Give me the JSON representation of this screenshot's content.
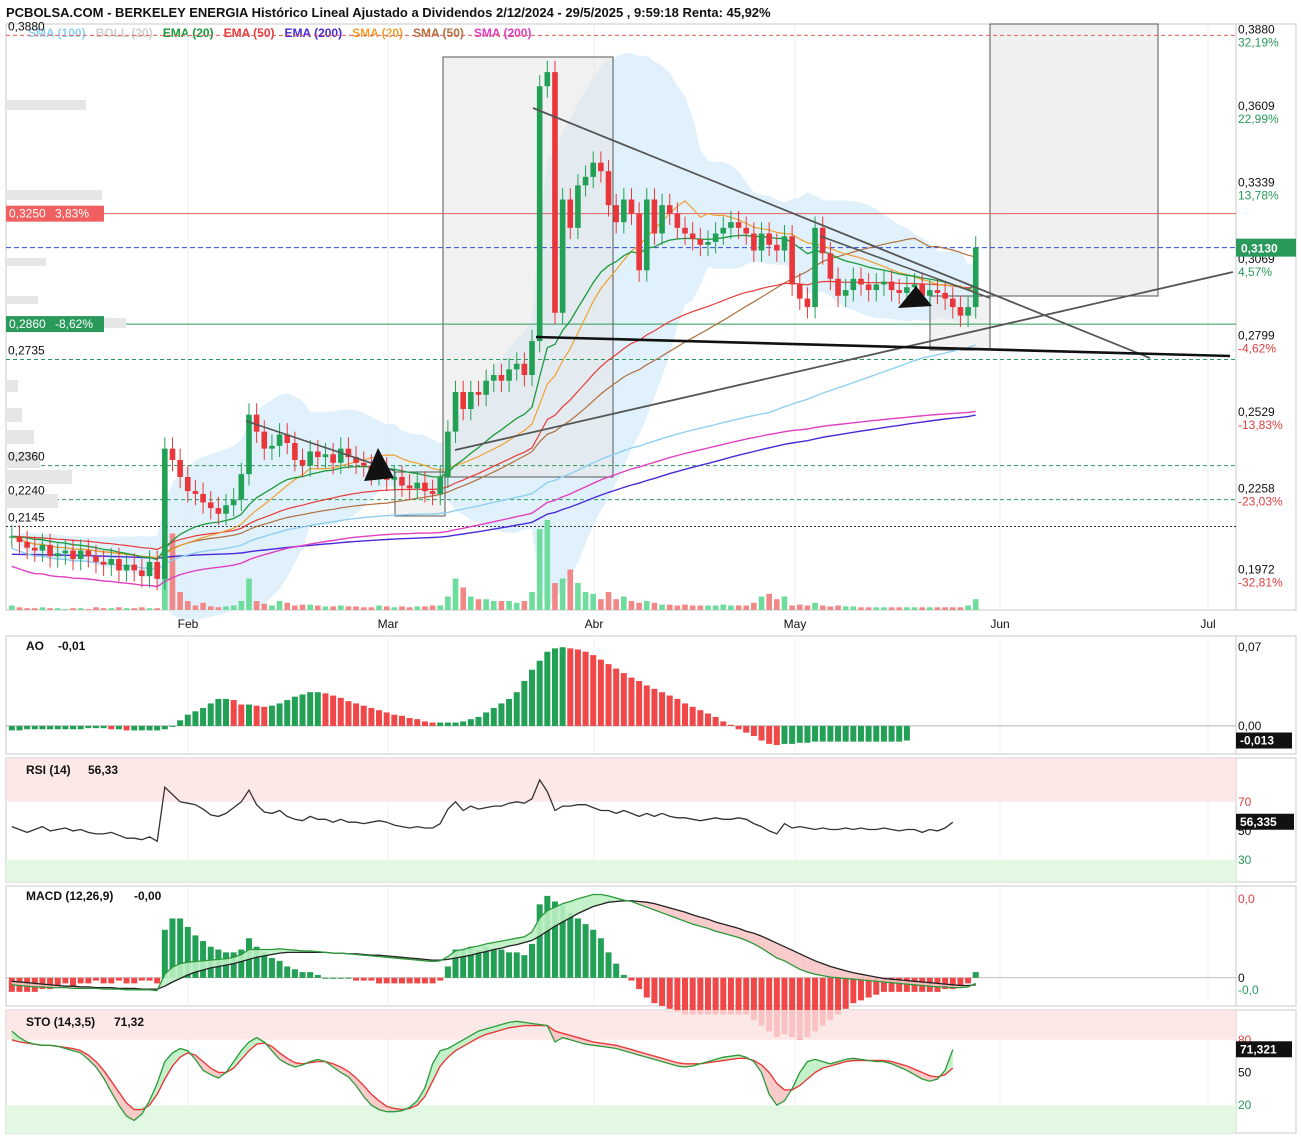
{
  "header": {
    "title": "PCBOLSA.COM - BERKELEY ENERGIA Histórico Lineal Ajustado a Dividendos 2/12/2024 - 29/5/2025 , 9:59:18 Renta: 45,92%"
  },
  "legend": [
    {
      "label": "SMA (100)",
      "color": "#8fd0f0"
    },
    {
      "label": "BOLL (20)",
      "color": "#d0d0d0"
    },
    {
      "label": "EMA (20)",
      "color": "#1a9a3a"
    },
    {
      "label": "EMA (50)",
      "color": "#e83a3a"
    },
    {
      "label": "EMA (200)",
      "color": "#4a2ad8"
    },
    {
      "label": "SMA (20)",
      "color": "#f0a030"
    },
    {
      "label": "SMA (50)",
      "color": "#b07040"
    },
    {
      "label": "SMA (200)",
      "color": "#e040c0"
    }
  ],
  "chart_data": [
    {
      "type": "candlestick",
      "name": "price",
      "x_labels": [
        "Feb",
        "Mar",
        "Abr",
        "May",
        "Jun",
        "Jul"
      ],
      "ylim": [
        0.185,
        0.392
      ],
      "right_axis_ticks": [
        {
          "value": "0,3880",
          "pct": "32,19%"
        },
        {
          "value": "0,3609",
          "pct": "22,99%"
        },
        {
          "value": "0,3339",
          "pct": "13,78%"
        },
        {
          "value": "0,3069",
          "pct": "4,57%"
        },
        {
          "value": "0,2799",
          "pct": "-4,62%"
        },
        {
          "value": "0,2529",
          "pct": "-13,83%"
        },
        {
          "value": "0,2258",
          "pct": "-23,03%"
        },
        {
          "value": "0,1972",
          "pct": "-32,81%"
        }
      ],
      "left_levels": [
        "0,3880",
        "0,2735",
        "0,2360",
        "0,2240",
        "0,2145"
      ],
      "last_price_label": "0,3130",
      "resistance_label": {
        "value": "0,3250",
        "pct": "3,83%"
      },
      "support_label": {
        "value": "0,2860",
        "pct": "-8,62%"
      },
      "closes": [
        0.211,
        0.209,
        0.207,
        0.206,
        0.208,
        0.204,
        0.205,
        0.206,
        0.203,
        0.206,
        0.204,
        0.202,
        0.201,
        0.203,
        0.199,
        0.201,
        0.199,
        0.197,
        0.202,
        0.196,
        0.242,
        0.238,
        0.232,
        0.227,
        0.226,
        0.223,
        0.221,
        0.219,
        0.222,
        0.224,
        0.233,
        0.254,
        0.248,
        0.242,
        0.243,
        0.247,
        0.244,
        0.238,
        0.236,
        0.241,
        0.239,
        0.24,
        0.237,
        0.242,
        0.239,
        0.237,
        0.236,
        0.233,
        0.235,
        0.231,
        0.232,
        0.229,
        0.228,
        0.23,
        0.227,
        0.226,
        0.232,
        0.248,
        0.262,
        0.256,
        0.262,
        0.261,
        0.266,
        0.268,
        0.266,
        0.27,
        0.272,
        0.268,
        0.28,
        0.37,
        0.375,
        0.29,
        0.33,
        0.32,
        0.335,
        0.338,
        0.343,
        0.34,
        0.328,
        0.322,
        0.33,
        0.325,
        0.305,
        0.33,
        0.318,
        0.328,
        0.325,
        0.32,
        0.318,
        0.316,
        0.314,
        0.315,
        0.318,
        0.32,
        0.322,
        0.32,
        0.318,
        0.312,
        0.318,
        0.314,
        0.312,
        0.317,
        0.3,
        0.295,
        0.292,
        0.32,
        0.311,
        0.302,
        0.296,
        0.298,
        0.302,
        0.3,
        0.298,
        0.3,
        0.301,
        0.298,
        0.297,
        0.299,
        0.3,
        0.296,
        0.298,
        0.297,
        0.295,
        0.292,
        0.289,
        0.292,
        0.313
      ],
      "volumes": [
        0.05,
        0.03,
        0.02,
        0.02,
        0.03,
        0.02,
        0.02,
        0.01,
        0.02,
        0.02,
        0.01,
        0.03,
        0.02,
        0.02,
        0.03,
        0.02,
        0.02,
        0.03,
        0.02,
        0.02,
        0.7,
        0.85,
        0.2,
        0.1,
        0.05,
        0.08,
        0.04,
        0.03,
        0.04,
        0.05,
        0.1,
        0.35,
        0.1,
        0.07,
        0.05,
        0.1,
        0.08,
        0.05,
        0.06,
        0.06,
        0.05,
        0.04,
        0.04,
        0.05,
        0.04,
        0.04,
        0.03,
        0.03,
        0.05,
        0.04,
        0.03,
        0.04,
        0.03,
        0.04,
        0.04,
        0.05,
        0.05,
        0.15,
        0.35,
        0.25,
        0.15,
        0.12,
        0.12,
        0.1,
        0.1,
        0.1,
        0.08,
        0.1,
        0.2,
        0.9,
        1.0,
        0.3,
        0.35,
        0.45,
        0.3,
        0.2,
        0.18,
        0.12,
        0.2,
        0.12,
        0.15,
        0.1,
        0.08,
        0.1,
        0.08,
        0.06,
        0.06,
        0.05,
        0.06,
        0.05,
        0.05,
        0.05,
        0.05,
        0.06,
        0.05,
        0.05,
        0.05,
        0.08,
        0.15,
        0.18,
        0.12,
        0.15,
        0.05,
        0.06,
        0.05,
        0.08,
        0.05,
        0.04,
        0.05,
        0.04,
        0.04,
        0.03,
        0.03,
        0.03,
        0.03,
        0.03,
        0.03,
        0.03,
        0.03,
        0.03,
        0.03,
        0.03,
        0.03,
        0.03,
        0.03,
        0.05,
        0.12
      ]
    },
    {
      "type": "bar",
      "name": "AO",
      "label": "AO",
      "current": "-0,01",
      "ylim": [
        -0.025,
        0.08
      ],
      "right_axis_ticks": [
        "0,07",
        "0,00"
      ],
      "last_label": "-0,013",
      "values": [
        -0.004,
        -0.004,
        -0.003,
        -0.003,
        -0.003,
        -0.003,
        -0.003,
        -0.003,
        -0.003,
        -0.003,
        -0.002,
        -0.002,
        -0.002,
        -0.003,
        -0.003,
        -0.004,
        -0.004,
        -0.004,
        -0.004,
        -0.004,
        -0.003,
        0.0,
        0.005,
        0.01,
        0.013,
        0.016,
        0.02,
        0.024,
        0.024,
        0.023,
        0.019,
        0.019,
        0.018,
        0.017,
        0.018,
        0.02,
        0.023,
        0.026,
        0.028,
        0.03,
        0.03,
        0.029,
        0.027,
        0.025,
        0.022,
        0.02,
        0.018,
        0.016,
        0.014,
        0.012,
        0.01,
        0.009,
        0.007,
        0.006,
        0.004,
        0.003,
        0.003,
        0.003,
        0.003,
        0.004,
        0.006,
        0.008,
        0.012,
        0.016,
        0.02,
        0.024,
        0.03,
        0.04,
        0.05,
        0.058,
        0.066,
        0.069,
        0.07,
        0.069,
        0.068,
        0.066,
        0.063,
        0.059,
        0.055,
        0.051,
        0.047,
        0.043,
        0.04,
        0.036,
        0.033,
        0.03,
        0.027,
        0.024,
        0.02,
        0.017,
        0.014,
        0.011,
        0.008,
        0.004,
        0.001,
        -0.003,
        -0.006,
        -0.009,
        -0.013,
        -0.016,
        -0.017,
        -0.016,
        -0.016,
        -0.015,
        -0.015,
        -0.014,
        -0.014,
        -0.014,
        -0.014,
        -0.014,
        -0.014,
        -0.014,
        -0.014,
        -0.014,
        -0.014,
        -0.014,
        -0.014,
        -0.013
      ]
    },
    {
      "type": "line",
      "name": "RSI",
      "label": "RSI (14)",
      "current": "56,33",
      "ylim": [
        15,
        100
      ],
      "bands": [
        30,
        70
      ],
      "right_axis_ticks": [
        "70",
        "50",
        "30"
      ],
      "last_label": "56,335",
      "values": [
        53,
        51,
        49,
        51,
        53,
        50,
        51,
        52,
        50,
        51,
        49,
        48,
        48,
        49,
        47,
        45,
        45,
        44,
        46,
        43,
        80,
        75,
        70,
        69,
        68,
        65,
        61,
        60,
        62,
        66,
        70,
        78,
        68,
        63,
        62,
        64,
        60,
        58,
        57,
        60,
        58,
        58,
        56,
        58,
        56,
        56,
        55,
        56,
        57,
        56,
        54,
        53,
        52,
        53,
        52,
        52,
        55,
        65,
        70,
        64,
        67,
        65,
        66,
        67,
        67,
        69,
        70,
        69,
        72,
        85,
        77,
        64,
        67,
        67,
        68,
        68,
        66,
        64,
        64,
        62,
        64,
        62,
        60,
        62,
        60,
        62,
        60,
        59,
        59,
        58,
        57,
        58,
        59,
        58,
        58,
        59,
        58,
        55,
        53,
        50,
        48,
        55,
        52,
        53,
        52,
        51,
        52,
        51,
        51,
        52,
        51,
        52,
        51,
        51,
        52,
        51,
        50,
        51,
        51,
        49,
        51,
        50,
        52,
        56
      ]
    },
    {
      "type": "line",
      "name": "MACD",
      "label": "MACD (12,26,9)",
      "current": "-0,00",
      "ylim": [
        -0.004,
        0.013
      ],
      "right_axis_ticks": [
        "0,0",
        "0",
        "-0,0"
      ],
      "macd": [
        -0.001,
        -0.0011,
        -0.0012,
        -0.0013,
        -0.0013,
        -0.0014,
        -0.0014,
        -0.0014,
        -0.0015,
        -0.0015,
        -0.0015,
        -0.0015,
        -0.0016,
        -0.0016,
        -0.0016,
        -0.0017,
        -0.0017,
        -0.0017,
        -0.0017,
        -0.0018,
        0.0005,
        0.0015,
        0.002,
        0.0022,
        0.0023,
        0.0024,
        0.0025,
        0.0026,
        0.0027,
        0.0029,
        0.0033,
        0.004,
        0.004,
        0.004,
        0.004,
        0.0041,
        0.004,
        0.0039,
        0.0038,
        0.0038,
        0.0037,
        0.0036,
        0.0035,
        0.0035,
        0.0034,
        0.0033,
        0.0032,
        0.0031,
        0.003,
        0.0029,
        0.0028,
        0.0027,
        0.0026,
        0.0025,
        0.0024,
        0.0023,
        0.0024,
        0.003,
        0.0038,
        0.004,
        0.0043,
        0.0045,
        0.0048,
        0.005,
        0.0052,
        0.0054,
        0.0056,
        0.0058,
        0.0065,
        0.0085,
        0.0095,
        0.01,
        0.0105,
        0.0108,
        0.0112,
        0.0115,
        0.0118,
        0.0118,
        0.0116,
        0.0113,
        0.011,
        0.0108,
        0.0104,
        0.01,
        0.0096,
        0.0092,
        0.0088,
        0.0084,
        0.008,
        0.0076,
        0.0073,
        0.007,
        0.0066,
        0.0063,
        0.006,
        0.0057,
        0.0053,
        0.0048,
        0.0042,
        0.0035,
        0.0028,
        0.0024,
        0.0018,
        0.0012,
        0.0008,
        0.0005,
        0.0003,
        0.0001,
        0.0,
        -0.0001,
        -0.0002,
        -0.0003,
        -0.0004,
        -0.0005,
        -0.0006,
        -0.0007,
        -0.0008,
        -0.0009,
        -0.001,
        -0.0011,
        -0.0012,
        -0.0013,
        -0.0013,
        -0.0014,
        -0.0014,
        -0.0013,
        -0.0008
      ],
      "signal": [
        -0.0005,
        -0.0006,
        -0.0007,
        -0.0008,
        -0.0009,
        -0.001,
        -0.0011,
        -0.0012,
        -0.0012,
        -0.0013,
        -0.0013,
        -0.0014,
        -0.0014,
        -0.0014,
        -0.0015,
        -0.0015,
        -0.0015,
        -0.0016,
        -0.0016,
        -0.0016,
        -0.0012,
        -0.0006,
        -0.0001,
        0.0004,
        0.0008,
        0.0011,
        0.0014,
        0.0016,
        0.0018,
        0.002,
        0.0023,
        0.0026,
        0.0029,
        0.0031,
        0.0033,
        0.0035,
        0.0036,
        0.0036,
        0.0036,
        0.0036,
        0.0036,
        0.0036,
        0.0035,
        0.0035,
        0.0034,
        0.0034,
        0.0033,
        0.0032,
        0.0032,
        0.0031,
        0.003,
        0.0029,
        0.0028,
        0.0027,
        0.0026,
        0.0025,
        0.0025,
        0.0026,
        0.0028,
        0.003,
        0.0032,
        0.0035,
        0.0037,
        0.004,
        0.0042,
        0.0045,
        0.0047,
        0.005,
        0.0053,
        0.0059,
        0.0066,
        0.0073,
        0.0079,
        0.0085,
        0.0091,
        0.0096,
        0.0101,
        0.0104,
        0.0107,
        0.0108,
        0.0109,
        0.0109,
        0.0108,
        0.0107,
        0.0105,
        0.0102,
        0.0099,
        0.0096,
        0.0093,
        0.0089,
        0.0086,
        0.0083,
        0.0079,
        0.0076,
        0.0073,
        0.007,
        0.0066,
        0.0063,
        0.0059,
        0.0054,
        0.0049,
        0.0044,
        0.0039,
        0.0034,
        0.0029,
        0.0024,
        0.002,
        0.0016,
        0.0013,
        0.001,
        0.0007,
        0.0005,
        0.0003,
        0.0001,
        -0.0001,
        -0.0002,
        -0.0003,
        -0.0004,
        -0.0005,
        -0.0006,
        -0.0007,
        -0.0008,
        -0.0009,
        -0.001,
        -0.0011,
        -0.0011,
        -0.001
      ]
    },
    {
      "type": "line",
      "name": "STO",
      "label": "STO (14,3,5)",
      "current": "71,32",
      "ylim": [
        0,
        100
      ],
      "bands": [
        20,
        80
      ],
      "right_axis_ticks": [
        "80",
        "50",
        "20"
      ],
      "last_label": "71,321",
      "k": [
        88,
        82,
        78,
        76,
        75,
        75,
        74,
        72,
        70,
        68,
        62,
        55,
        45,
        32,
        20,
        10,
        6,
        12,
        24,
        40,
        60,
        68,
        72,
        70,
        62,
        52,
        48,
        45,
        50,
        60,
        70,
        78,
        82,
        78,
        70,
        62,
        58,
        55,
        57,
        60,
        62,
        60,
        55,
        50,
        46,
        38,
        28,
        20,
        16,
        14,
        14,
        15,
        18,
        24,
        36,
        58,
        70,
        72,
        76,
        80,
        84,
        88,
        90,
        92,
        94,
        96,
        97,
        96,
        95,
        94,
        93,
        78,
        82,
        80,
        78,
        76,
        75,
        74,
        73,
        72,
        70,
        68,
        66,
        64,
        62,
        60,
        58,
        56,
        55,
        56,
        58,
        60,
        62,
        64,
        65,
        66,
        64,
        60,
        50,
        30,
        20,
        24,
        35,
        50,
        60,
        62,
        60,
        58,
        60,
        62,
        63,
        62,
        61,
        60,
        60,
        58,
        55,
        52,
        48,
        44,
        42,
        44,
        52,
        71
      ]
    },
    {
      "type": "line",
      "name": "STO-D",
      "d": [
        80,
        78,
        77,
        76,
        75,
        75,
        74,
        73,
        72,
        70,
        66,
        60,
        52,
        42,
        32,
        22,
        16,
        16,
        20,
        30,
        44,
        56,
        64,
        68,
        66,
        60,
        54,
        50,
        50,
        54,
        62,
        70,
        76,
        77,
        74,
        68,
        63,
        59,
        58,
        59,
        60,
        60,
        58,
        55,
        51,
        45,
        38,
        30,
        24,
        19,
        17,
        16,
        17,
        20,
        28,
        42,
        56,
        64,
        70,
        74,
        78,
        82,
        85,
        87,
        89,
        91,
        92,
        93,
        93,
        93,
        93,
        88,
        86,
        84,
        82,
        80,
        78,
        77,
        76,
        75,
        73,
        71,
        69,
        67,
        65,
        63,
        61,
        59,
        58,
        58,
        58,
        59,
        60,
        61,
        62,
        63,
        63,
        61,
        57,
        50,
        40,
        34,
        34,
        38,
        44,
        50,
        54,
        56,
        58,
        60,
        61,
        61,
        61,
        61,
        61,
        60,
        58,
        56,
        53,
        50,
        47,
        46,
        48,
        54
      ]
    }
  ]
}
